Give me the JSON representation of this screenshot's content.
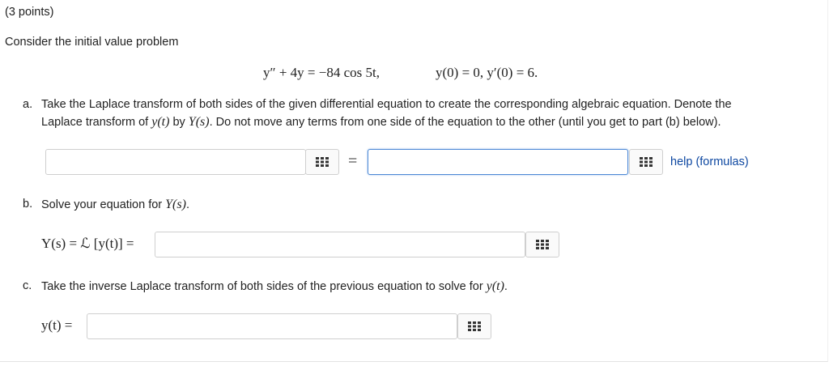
{
  "points": "(3 points)",
  "intro": "Consider the initial value problem",
  "ode": {
    "lhs": "y″ + 4y = −84 cos 5t,",
    "conditions": "y(0) = 0,  y′(0) = 6."
  },
  "part_a": {
    "letter": "a.",
    "line1": "Take the Laplace transform of both sides of the given differential equation to create the corresponding algebraic equation. Denote the",
    "line2_prefix": "Laplace transform of ",
    "line2_yt": "y(t)",
    "line2_by": " by ",
    "line2_Ys": "Y(s)",
    "line2_suffix": ". Do not move any terms from one side of the equation to the other (until you get to part (b) below).",
    "equals": "=",
    "left_value": "",
    "right_value": "",
    "help_link": "help (formulas)"
  },
  "part_b": {
    "letter": "b.",
    "text_prefix": "Solve your equation for ",
    "text_Ys": "Y(s)",
    "text_suffix": ".",
    "label": "Y(s) = ℒ [y(t)] =",
    "value": ""
  },
  "part_c": {
    "letter": "c.",
    "text_prefix": "Take the inverse Laplace transform of both sides of the previous equation to solve for ",
    "text_yt": "y(t)",
    "text_suffix": ".",
    "label": "y(t) =",
    "value": ""
  },
  "icons": {
    "matrix_button": "matrix-grid-icon"
  }
}
